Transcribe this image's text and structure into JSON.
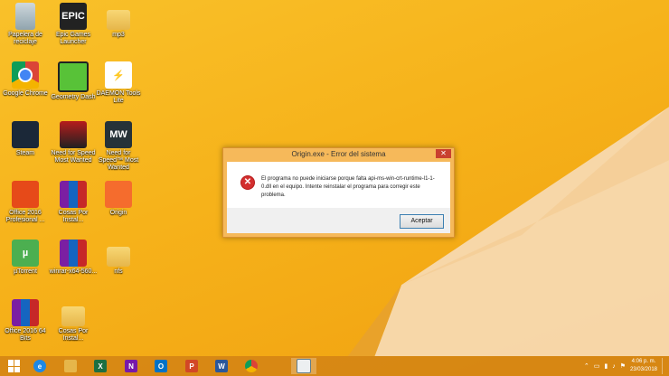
{
  "desktop_icons": [
    {
      "label": "Papelera de reciclaje",
      "icon": "recycle-bin-icon"
    },
    {
      "label": "Epic Games Launcher",
      "icon": "epic-games-icon",
      "glyph": "EPIC"
    },
    {
      "label": "mp3",
      "icon": "folder-icon"
    },
    {
      "label": "Google Chrome",
      "icon": "chrome-icon"
    },
    {
      "label": "Geometry Dash",
      "icon": "geometry-dash-icon"
    },
    {
      "label": "DAEMON Tools Lite",
      "icon": "daemon-tools-icon"
    },
    {
      "label": "Steam",
      "icon": "steam-icon"
    },
    {
      "label": "Need for Speed Most Wanted",
      "icon": "nfs-most-wanted-icon"
    },
    {
      "label": "Need for Speed™ Most Wanted",
      "icon": "nfs-mw-icon",
      "glyph": "MW"
    },
    {
      "label": "Office 2016 Profesional ...",
      "icon": "office-icon"
    },
    {
      "label": "Cosas Por Instal...",
      "icon": "winrar-icon"
    },
    {
      "label": "Origin",
      "icon": "origin-icon"
    },
    {
      "label": "µTorrent",
      "icon": "utorrent-icon",
      "glyph": "µ"
    },
    {
      "label": "winrar-x64-560...",
      "icon": "winrar-icon"
    },
    {
      "label": "nfs",
      "icon": "folder-icon"
    },
    {
      "label": "Office 2016 64 Bits",
      "icon": "winrar-icon"
    },
    {
      "label": "Cosas Por Instal...",
      "icon": "folder-icon"
    }
  ],
  "dialog": {
    "title": "Origin.exe - Error del sistema",
    "close_glyph": "✕",
    "error_glyph": "✕",
    "message": "El programa no puede iniciarse porque falta api-ms-win-crt-runtime-l1-1-0.dll en el equipo. Intente reinstalar el programa para corregir este problema.",
    "ok_label": "Aceptar"
  },
  "taskbar": {
    "items": [
      {
        "name": "internet-explorer-icon",
        "glyph": "e",
        "color": "#1e88e5"
      },
      {
        "name": "file-explorer-icon",
        "glyph": "",
        "color": "#e6b64a"
      },
      {
        "name": "excel-icon",
        "glyph": "X",
        "color": "#1d6f42"
      },
      {
        "name": "onenote-icon",
        "glyph": "N",
        "color": "#7719aa"
      },
      {
        "name": "outlook-icon",
        "glyph": "O",
        "color": "#0072c6"
      },
      {
        "name": "powerpoint-icon",
        "glyph": "P",
        "color": "#d24726"
      },
      {
        "name": "word-icon",
        "glyph": "W",
        "color": "#2b579a"
      },
      {
        "name": "chrome-icon",
        "glyph": "",
        "color": "#4285f4"
      },
      {
        "name": "error-window-icon",
        "glyph": "",
        "color": "#607d8b"
      }
    ],
    "time": "4:06 p. m.",
    "date": "23/03/2018"
  },
  "colors": {
    "accent": "#f6b21a",
    "error": "#d32f2f"
  }
}
